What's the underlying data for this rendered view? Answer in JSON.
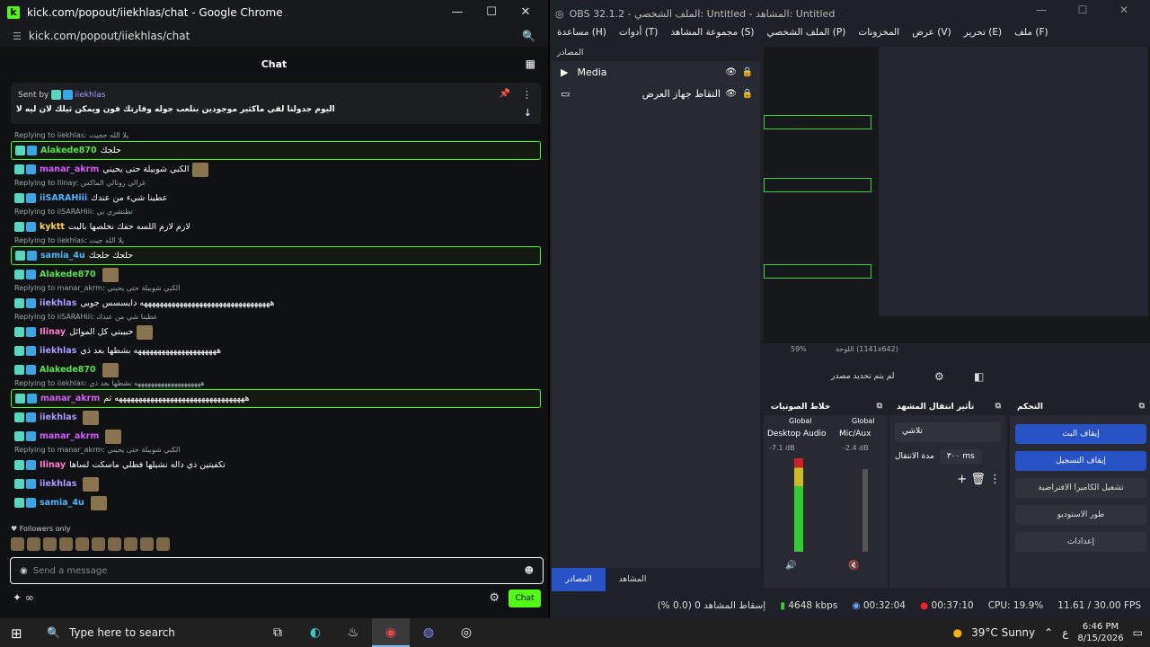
{
  "chrome": {
    "title": "kick.com/popout/iiekhlas/chat - Google Chrome",
    "url": "kick.com/popout/iiekhlas/chat",
    "chat_title": "Chat",
    "pinned": {
      "sent_by": "Sent by",
      "user": "iiekhlas",
      "message": "اليوم جدولنا لقي ماكثير موجودين بنلعب جوله وقارتك فون ويمكن ثيلك لان ليه لا"
    },
    "messages": [
      {
        "reply": "Replying to iiekhlas: يلا الله حجيت",
        "user": "Alakede870",
        "color": "#55e24f",
        "text": "حلجك",
        "hl": true
      },
      {
        "user": "manar_akrm",
        "color": "#d45bff",
        "text": "الكبي شوبيلة حتى يحيني",
        "emote": true
      },
      {
        "reply": "Replying to Ilinay: غرالي رونالي الماكس",
        "user": "iiSARAHiii",
        "color": "#4fb3ff",
        "text": "عطينا شيء من عندك"
      },
      {
        "reply": "Replying to iiSARAHiii: تطنشري بي",
        "user": "kyktt",
        "color": "#ffd84f",
        "text": "لازم لازم اللسه حفك نخلصها باليت"
      },
      {
        "reply": "Replying to iiekhlas: يلا الله جيت",
        "user": "samia_4u",
        "color": "#4fb3ff",
        "text": "حلجك حلجك",
        "hl": true
      },
      {
        "user": "Alakede870",
        "color": "#55e24f",
        "text": "",
        "emote": true
      },
      {
        "reply": "Replying to manar_akrm: الكبي شوبيلة حتى يحيني",
        "user": "iiekhlas",
        "color": "#a89bff",
        "text": "هههههههههههههههههههههههههههههههههه دايسسس جويي"
      },
      {
        "reply": "Replying to iiSARAHiii: عطينا شي من عندك",
        "user": "Ilinay",
        "color": "#ff7bd5",
        "text": "حبيبتي كل الموائل",
        "emote": true
      },
      {
        "user": "iiekhlas",
        "color": "#a89bff",
        "text": "هههههههههههههههههههههه بشطها بعد ذي"
      },
      {
        "user": "Alakede870",
        "color": "#55e24f",
        "text": "",
        "emote": true
      },
      {
        "reply": "Replying to iiekhlas: ههههههههههههههههههههه بشطها بعد ذي",
        "user": "manar_akrm",
        "color": "#d45bff",
        "text": "هههههههههههههههههههههههههههههههههه ثم",
        "hl": true
      },
      {
        "user": "iiekhlas",
        "color": "#a89bff",
        "text": "",
        "emote": true
      },
      {
        "user": "manar_akrm",
        "color": "#d45bff",
        "text": "",
        "emote": true
      },
      {
        "reply": "Replying to manar_akrm: الكبي شوبيلة حتى يحيني",
        "user": "Ilinay",
        "color": "#ff7bd5",
        "text": "تكفيتين ذي داله نشيلها فطلي ماسكت لساها"
      },
      {
        "user": "iiekhlas",
        "color": "#a89bff",
        "text": "",
        "emote": true
      },
      {
        "user": "samia_4u",
        "color": "#4fb3ff",
        "text": "",
        "emote": true
      }
    ],
    "followers": "Followers only",
    "placeholder": "Send a message",
    "chat_button": "Chat"
  },
  "obs": {
    "title": "OBS 32.1.2 - الملف الشخصي: Untitled - المشاهد: Untitled",
    "menu": [
      "ملف (F)",
      "تحرير (E)",
      "عرض (V)",
      "المخزونات",
      "الملف الشخصي (P)",
      "مجموعة المشاهد (S)",
      "أدوات (T)",
      "مساعدة (H)"
    ],
    "sources_header": "المصادر",
    "sources": [
      {
        "name": "Media",
        "icon": "play-icon"
      },
      {
        "name": "التقاط جهاز العرض",
        "icon": "monitor-icon"
      }
    ],
    "zoom": "59%",
    "canvas_info": "اللوحة (1141x642)",
    "no_source": "لم يتم تحديد مصدر",
    "mixer_header": "خلاط الصوتيات",
    "transitions_header": "تأثير انتقال المشهد",
    "controls_header": "التحكم",
    "mixer": [
      {
        "label": "Global",
        "name": "Desktop Audio",
        "db": "-7.1 dB"
      },
      {
        "label": "Global",
        "name": "Mic/Aux",
        "db": "-2.4 dB"
      }
    ],
    "transition": "تلاشي",
    "duration_label": "مدة الانتقال",
    "duration": "٣٠٠ ms",
    "controls": [
      "إيقاف البث",
      "إيقاف التسجيل",
      "تشغيل الكاميرا الافتراضية",
      "طور الاستوديو",
      "إعدادات"
    ],
    "tabs": [
      "المصادر",
      "المشاهد"
    ],
    "status": {
      "dropped": "إسقاط المشاهد 0 (0.0 %)",
      "bitrate": "4648 kbps",
      "stream_time": "00:32:04",
      "rec_time": "00:37:10",
      "cpu": "CPU: 19.9%",
      "fps": "11.61 / 30.00 FPS"
    }
  },
  "taskbar": {
    "search": "Type here to search",
    "weather": "39°C  Sunny",
    "lang": "ع",
    "time": "6:46 PM",
    "date": "8/15/2026"
  }
}
